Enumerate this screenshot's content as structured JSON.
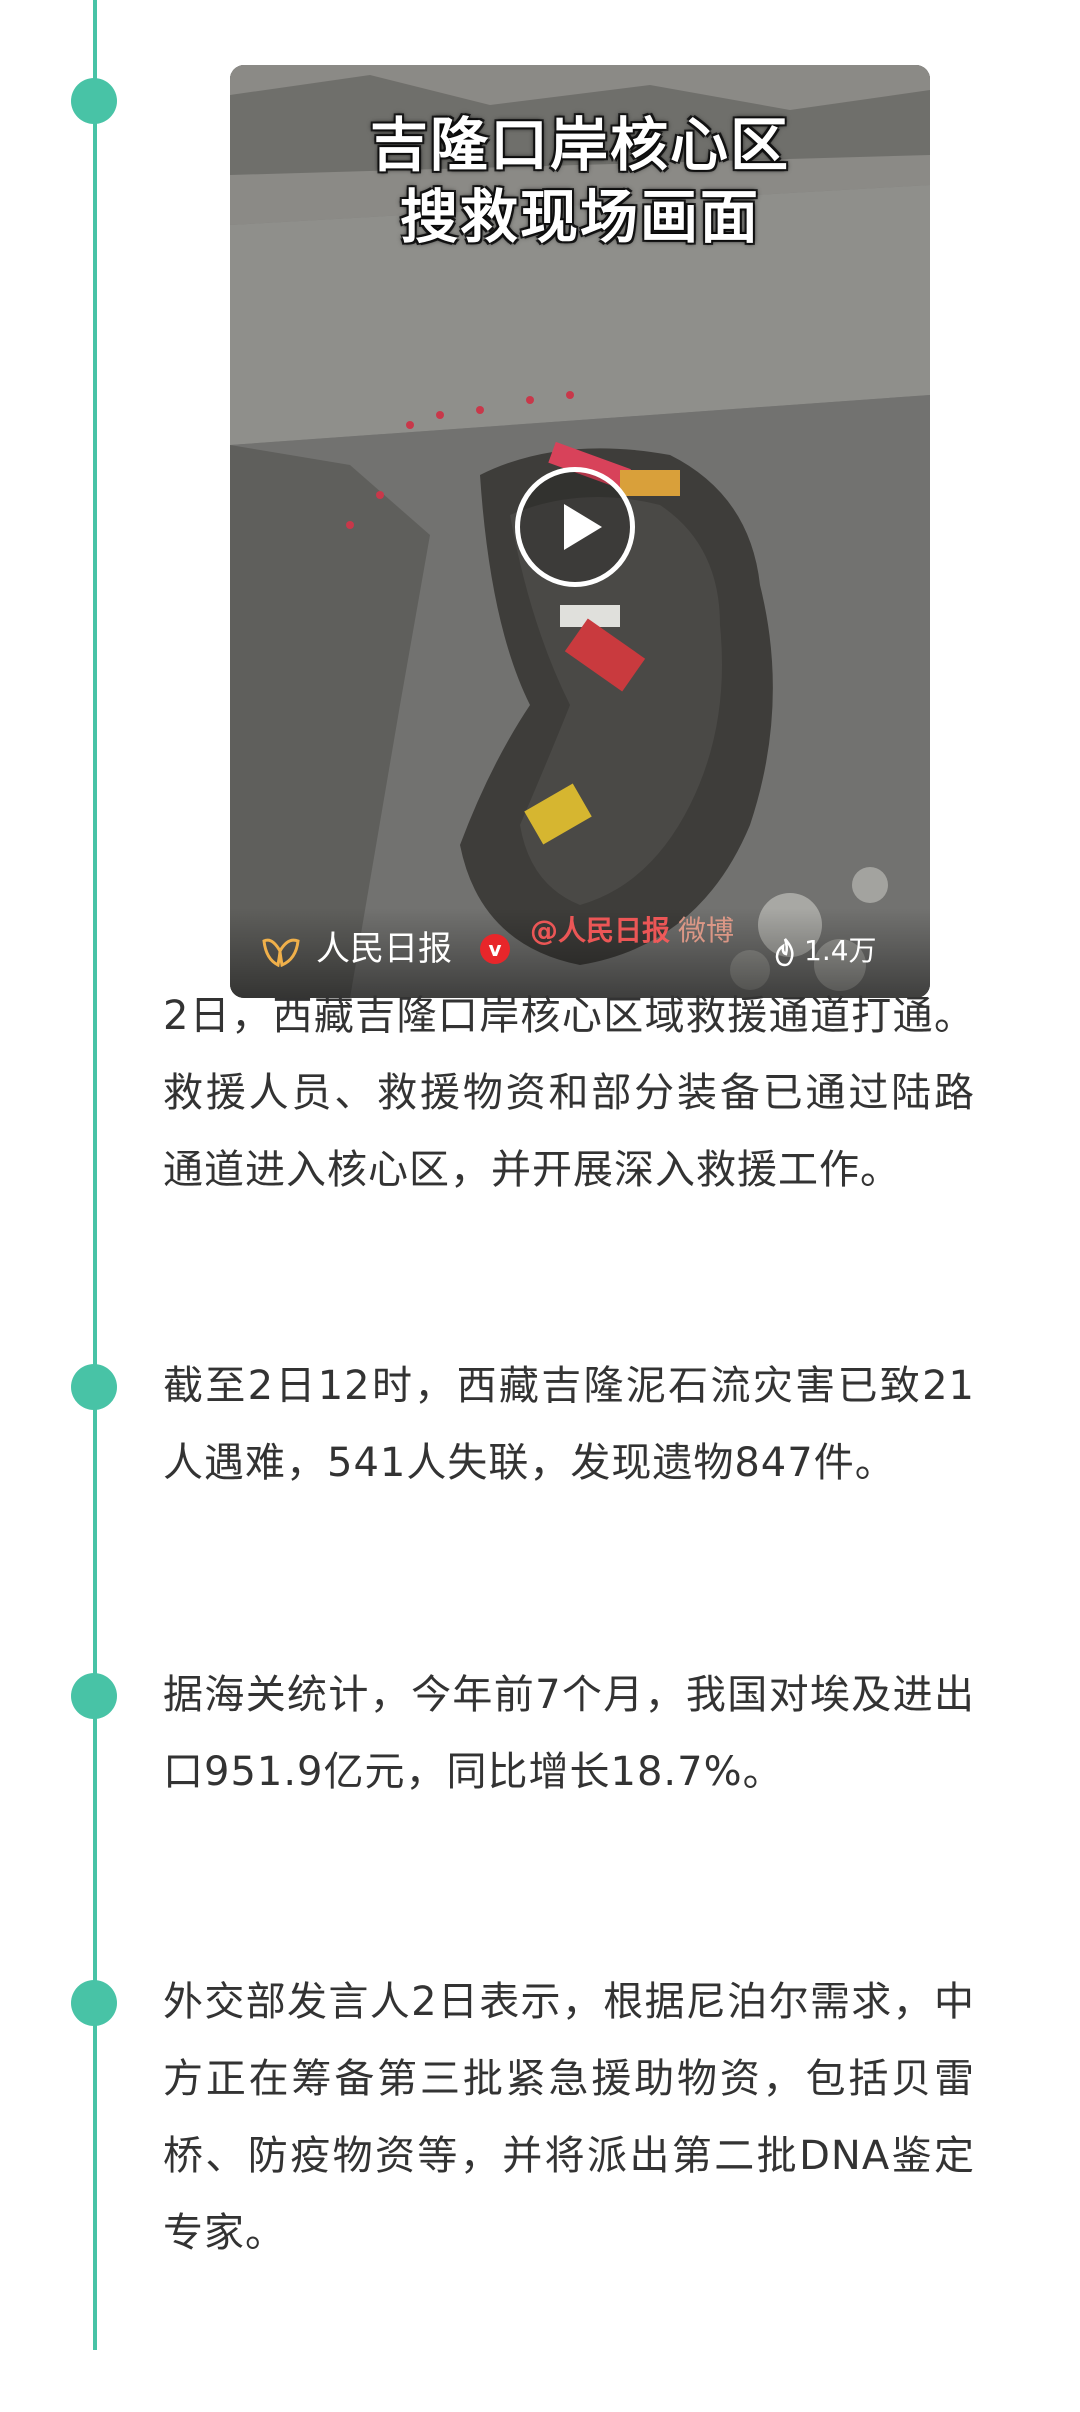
{
  "video": {
    "title_line1": "吉隆口岸核心区",
    "title_line2": "搜救现场画面",
    "source": "人民日报",
    "verified_mark": "v",
    "watermark": "@人民日报",
    "watermark_platform": "微博",
    "view_count": "1.4万"
  },
  "items": [
    {
      "text": "2日，西藏吉隆口岸核心区域救援通道打通。救援人员、救援物资和部分装备已通过陆路通道进入核心区，并开展深入救援工作。"
    },
    {
      "text": "截至2日12时，西藏吉隆泥石流灾害已致21人遇难，541人失联，发现遗物847件。"
    },
    {
      "text": "据海关统计，今年前7个月，我国对埃及进出口951.9亿元，同比增长18.7%。"
    },
    {
      "text": "外交部发言人2日表示，根据尼泊尔需求，中方正在筹备第三批紧急援助物资，包括贝雷桥、防疫物资等，并将派出第二批DNA鉴定专家。"
    }
  ],
  "colors": {
    "accent": "#48c3a6",
    "text": "#333333",
    "verified": "#e8262a"
  }
}
